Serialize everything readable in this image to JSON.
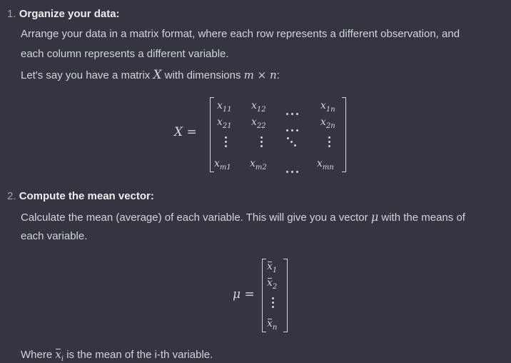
{
  "step1": {
    "number": "1.",
    "heading": "Organize your data:",
    "line1": "Arrange your data in a matrix format, where each row represents a different observation, and",
    "line2": "each column represents a different variable.",
    "line3_prefix": "Let's say you have a matrix",
    "line3_var": "X",
    "line3_mid": "with dimensions",
    "line3_dims": "m × n",
    "line3_suffix": ":"
  },
  "matrix_X": {
    "lhs": "X =",
    "rows": [
      [
        "x11",
        "x12",
        "⋯",
        "x1n"
      ],
      [
        "x21",
        "x22",
        "⋯",
        "x2n"
      ],
      [
        "⋮",
        "⋮",
        "⋱",
        "⋮"
      ],
      [
        "xm1",
        "xm2",
        "⋯",
        "xmn"
      ]
    ],
    "subscripts": [
      [
        "11",
        "12",
        "1n"
      ],
      [
        "21",
        "22",
        "2n"
      ],
      [
        "m1",
        "m2",
        "mn"
      ]
    ]
  },
  "step2": {
    "number": "2.",
    "heading": "Compute the mean vector:",
    "line1_prefix": "Calculate the mean (average) of each variable. This will give you a vector",
    "line1_var": "μ",
    "line1_suffix": "with the means of",
    "line2": "each variable."
  },
  "vector_mu": {
    "lhs": "μ =",
    "entries": [
      "1",
      "2",
      "n"
    ]
  },
  "footer": {
    "prefix": "Where",
    "var_sub": "i",
    "suffix": "is the mean of the i-th variable."
  }
}
